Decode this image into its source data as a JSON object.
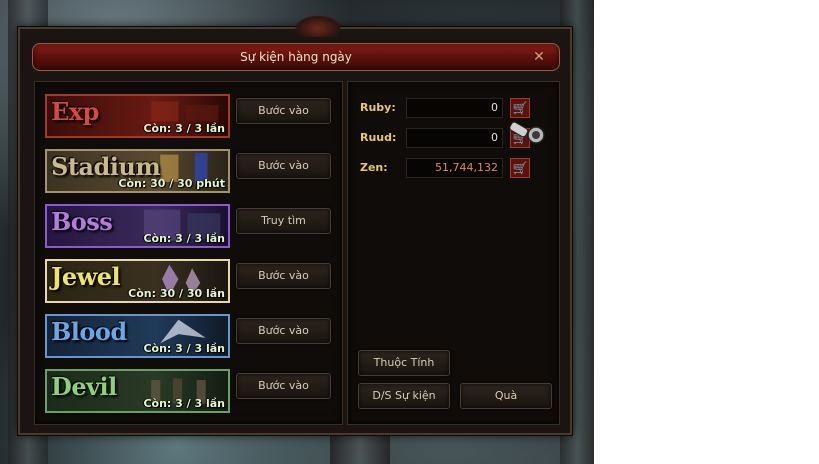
{
  "window": {
    "title": "Sự kiện hàng ngày"
  },
  "events": [
    {
      "name": "Exp",
      "remaining": "Còn: 3 / 3 lần",
      "button": "Bước vào",
      "name_color": "#d84a3a",
      "border": "#a03a2a",
      "bg": "#3a0e0b"
    },
    {
      "name": "Stadium",
      "remaining": "Còn: 30 / 30 phút",
      "button": "Bước vào",
      "name_color": "#c9b98d",
      "border": "#a3926a",
      "bg": "#3b3322"
    },
    {
      "name": "Boss",
      "remaining": "Còn: 3 / 3 lần",
      "button": "Truy tìm",
      "name_color": "#b47be0",
      "border": "#8a5ad0",
      "bg": "#241640"
    },
    {
      "name": "Jewel",
      "remaining": "Còn: 30 / 30 lần",
      "button": "Bước vào",
      "name_color": "#f0e36a",
      "border": "#e6d8a8",
      "bg": "#2b2412"
    },
    {
      "name": "Blood",
      "remaining": "Còn: 3 / 3 lần",
      "button": "Bước vào",
      "name_color": "#6aa6e8",
      "border": "#6a96c8",
      "bg": "#14243a"
    },
    {
      "name": "Devil",
      "remaining": "Còn: 3 / 3 lần",
      "button": "Bước vào",
      "name_color": "#8ed07a",
      "border": "#6aa068",
      "bg": "#1b2a1a"
    }
  ],
  "currency": [
    {
      "label": "Ruby:",
      "value": "0",
      "value_color": "#e8dfc9"
    },
    {
      "label": "Ruud:",
      "value": "0",
      "value_color": "#e8dfc9"
    },
    {
      "label": "Zen:",
      "value": "51,744,132",
      "value_color": "#e88a3a"
    }
  ],
  "buttons": {
    "attributes": "Thuộc Tính",
    "event_list": "D/S Sự kiện",
    "rewards": "Quà"
  },
  "icons": {
    "close": "✕",
    "cart": "🛒"
  }
}
